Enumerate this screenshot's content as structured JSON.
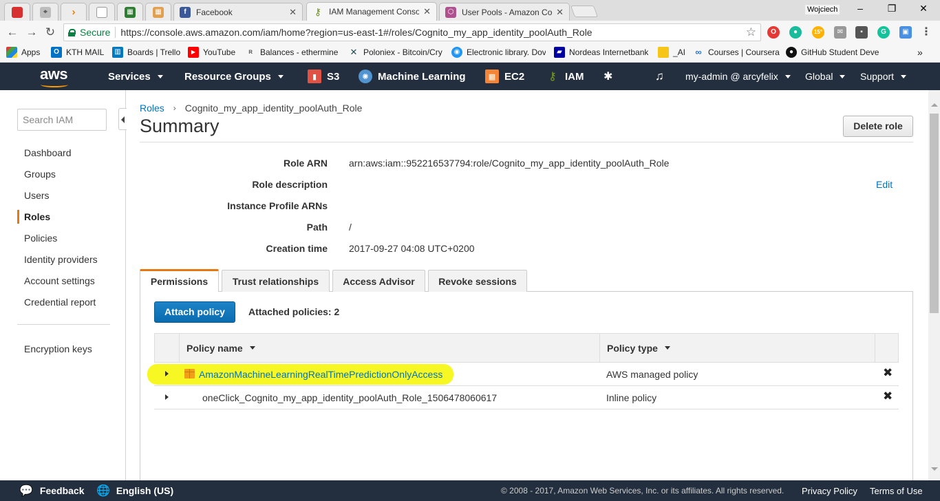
{
  "browser": {
    "tabs": [
      {
        "label": "",
        "icon": "opera-icon",
        "color": "#d63031"
      },
      {
        "label": "",
        "icon": "tool-icon",
        "color": "#9a9a9a"
      },
      {
        "label": "",
        "icon": "sublime-icon",
        "color": "#f57c00"
      },
      {
        "label": "",
        "icon": "document-icon",
        "color": "#9e9e9e"
      },
      {
        "label": "",
        "icon": "sheet-icon",
        "color": "#2e7d32"
      },
      {
        "label": "",
        "icon": "grid-icon",
        "color": "#e0a050"
      },
      {
        "label": "Facebook",
        "icon": "facebook-icon",
        "color": "#3b5998"
      },
      {
        "label": "IAM Management Conso",
        "icon": "iam-icon",
        "color": "#6b8e23"
      },
      {
        "label": "User Pools - Amazon Co",
        "icon": "cognito-icon",
        "color": "#b0508f"
      }
    ],
    "user": "Wojciech",
    "address": {
      "secure_label": "Secure",
      "url": "https://console.aws.amazon.com/iam/home?region=us-east-1#/roles/Cognito_my_app_identity_poolAuth_Role"
    },
    "extensions": [
      {
        "icon": "opera-icon",
        "color": "#e53935",
        "label": "O"
      },
      {
        "icon": "chat-icon",
        "color": "#1abc9c",
        "label": ""
      },
      {
        "icon": "weather-icon",
        "color": "#ffb300",
        "label": "15°"
      },
      {
        "icon": "mail-icon",
        "color": "#888888",
        "label": ""
      },
      {
        "icon": "pocket-icon",
        "color": "#555555",
        "label": ""
      },
      {
        "icon": "grammarly-icon",
        "color": "#15c39a",
        "label": "G"
      },
      {
        "icon": "screenshot-icon",
        "color": "#4a90e2",
        "label": ""
      },
      {
        "icon": "menu-icon",
        "color": "#666666",
        "label": "⋮"
      }
    ],
    "bookmarks": [
      {
        "label": "Apps",
        "icon": "apps-icon",
        "color": "#e53935"
      },
      {
        "label": "KTH MAIL",
        "icon": "outlook-icon",
        "color": "#0072c6"
      },
      {
        "label": "Boards | Trello",
        "icon": "trello-icon",
        "color": "#0079bf"
      },
      {
        "label": "YouTube",
        "icon": "youtube-icon",
        "color": "#ff0000"
      },
      {
        "label": "Balances - ethermine",
        "icon": "ethermine-icon",
        "color": "#777777"
      },
      {
        "label": "Poloniex - Bitcoin/Cry",
        "icon": "poloniex-icon",
        "color": "#1f4d53"
      },
      {
        "label": "Electronic library. Dov",
        "icon": "library-icon",
        "color": "#2196f3"
      },
      {
        "label": "Nordeas Internetbank",
        "icon": "nordea-icon",
        "color": "#0000a0"
      },
      {
        "label": "_AI",
        "icon": "folder-icon",
        "color": "#f5c518"
      },
      {
        "label": "Courses | Coursera",
        "icon": "coursera-icon",
        "color": "#2a73cc"
      },
      {
        "label": "GitHub Student Deve",
        "icon": "github-icon",
        "color": "#111111"
      }
    ],
    "bookmarks_more": "»"
  },
  "aws_nav": {
    "logo": "aws",
    "services": "Services",
    "resource_groups": "Resource Groups",
    "shortcuts": [
      {
        "label": "S3",
        "icon": "s3-icon",
        "color": "#e05243"
      },
      {
        "label": "Machine Learning",
        "icon": "machine-learning-icon",
        "color": "#5294cf"
      },
      {
        "label": "EC2",
        "icon": "ec2-icon",
        "color": "#f58536"
      },
      {
        "label": "IAM",
        "icon": "iam-icon",
        "color": "#7aa116"
      }
    ],
    "account": "my-admin @ arcyfelix",
    "region": "Global",
    "support": "Support"
  },
  "sidebar": {
    "search_placeholder": "Search IAM",
    "items": [
      {
        "label": "Dashboard"
      },
      {
        "label": "Groups"
      },
      {
        "label": "Users"
      },
      {
        "label": "Roles",
        "active": true
      },
      {
        "label": "Policies"
      },
      {
        "label": "Identity providers"
      },
      {
        "label": "Account settings"
      },
      {
        "label": "Credential report"
      }
    ],
    "bottom_items": [
      {
        "label": "Encryption keys"
      }
    ]
  },
  "breadcrumb": {
    "parent": "Roles",
    "separator": "›",
    "current": "Cognito_my_app_identity_poolAuth_Role"
  },
  "page": {
    "title": "Summary",
    "delete_button": "Delete role"
  },
  "summary": {
    "rows": [
      {
        "label": "Role ARN",
        "value": "arn:aws:iam::952216537794:role/Cognito_my_app_identity_poolAuth_Role"
      },
      {
        "label": "Role description",
        "value": ""
      },
      {
        "label": "Instance Profile ARNs",
        "value": ""
      },
      {
        "label": "Path",
        "value": "/"
      },
      {
        "label": "Creation time",
        "value": "2017-09-27 04:08 UTC+0200"
      }
    ],
    "edit_label": "Edit"
  },
  "tabs": [
    {
      "label": "Permissions",
      "active": true
    },
    {
      "label": "Trust relationships"
    },
    {
      "label": "Access Advisor"
    },
    {
      "label": "Revoke sessions"
    }
  ],
  "permissions": {
    "attach_button": "Attach policy",
    "attached_count": "Attached policies: 2",
    "columns": [
      {
        "label": "Policy name"
      },
      {
        "label": "Policy type"
      }
    ],
    "policies": [
      {
        "name": "AmazonMachineLearningRealTimePredictionOnlyAccess",
        "type": "AWS managed policy",
        "managed": true,
        "highlighted": true,
        "highlight_color": "#f7f724"
      },
      {
        "name": "oneClick_Cognito_my_app_identity_poolAuth_Role_1506478060617",
        "type": "Inline policy",
        "managed": false,
        "highlighted": false
      }
    ],
    "remove_glyph": "✖"
  },
  "footer": {
    "feedback": "Feedback",
    "language": "English (US)",
    "copyright": "© 2008 - 2017, Amazon Web Services, Inc. or its affiliates. All rights reserved.",
    "privacy": "Privacy Policy",
    "terms": "Terms of Use"
  },
  "colors": {
    "aws_nav": "#232f3e",
    "accent_orange": "#e47911",
    "link_blue": "#0073bb",
    "primary_button": "#0a6cb0"
  }
}
